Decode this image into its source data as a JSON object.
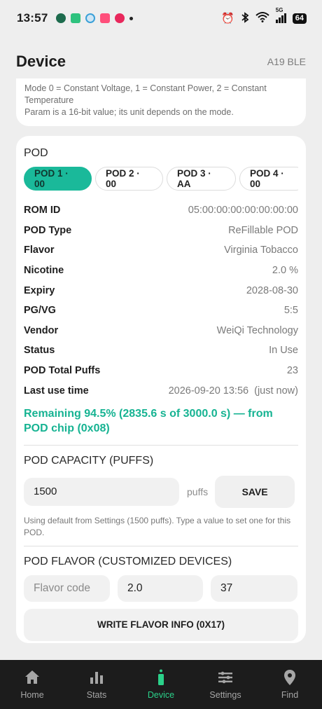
{
  "status": {
    "time": "13:57",
    "battery": "64",
    "network": "5G"
  },
  "header": {
    "title": "Device",
    "model": "A19 BLE"
  },
  "mode_note": {
    "line1": "Mode 0 = Constant Voltage, 1 = Constant Power, 2 = Constant",
    "line2": "Temperature",
    "line3": "Param is a 16-bit value; its unit depends on the mode."
  },
  "pod": {
    "section_label": "POD",
    "tabs": [
      {
        "label": "POD 1 · 00",
        "active": true
      },
      {
        "label": "POD 2 · 00",
        "active": false
      },
      {
        "label": "POD 3 · AA",
        "active": false
      },
      {
        "label": "POD 4 · 00",
        "active": false
      }
    ],
    "info": [
      {
        "key": "ROM ID",
        "value": "05:00:00:00:00:00:00:00"
      },
      {
        "key": "POD Type",
        "value": "ReFillable POD"
      },
      {
        "key": "Flavor",
        "value": "Virginia Tobacco"
      },
      {
        "key": "Nicotine",
        "value": "2.0 %"
      },
      {
        "key": "Expiry",
        "value": "2028-08-30"
      },
      {
        "key": "PG/VG",
        "value": "5:5"
      },
      {
        "key": "Vendor",
        "value": "WeiQi Technology"
      },
      {
        "key": "Status",
        "value": "In Use"
      },
      {
        "key": "POD Total Puffs",
        "value": "23"
      },
      {
        "key": "Last use time",
        "value": "2026-09-20 13:56  (just now)"
      }
    ],
    "remaining_text": "Remaining 94.5% (2835.6 s of 3000.0 s) — from POD chip (0x08)"
  },
  "capacity": {
    "title": "POD CAPACITY (PUFFS)",
    "value": "1500",
    "unit": "puffs",
    "save_label": "SAVE",
    "help": "Using default from Settings (1500 puffs). Type a value to set one for this POD."
  },
  "flavor": {
    "title": "POD FLAVOR (CUSTOMIZED DEVICES)",
    "code_placeholder": "Flavor code",
    "field2": "2.0",
    "field3": "37",
    "write_label": "WRITE FLAVOR INFO (0X17)"
  },
  "nav": [
    {
      "label": "Home",
      "icon": "home-icon",
      "active": false
    },
    {
      "label": "Stats",
      "icon": "stats-icon",
      "active": false
    },
    {
      "label": "Device",
      "icon": "device-icon",
      "active": true
    },
    {
      "label": "Settings",
      "icon": "settings-icon",
      "active": false
    },
    {
      "label": "Find",
      "icon": "location-pin-icon",
      "active": false
    }
  ],
  "colors": {
    "accent": "#1ab99a",
    "nav_active": "#2bd18a",
    "nav_bg": "#1c1c1c"
  }
}
